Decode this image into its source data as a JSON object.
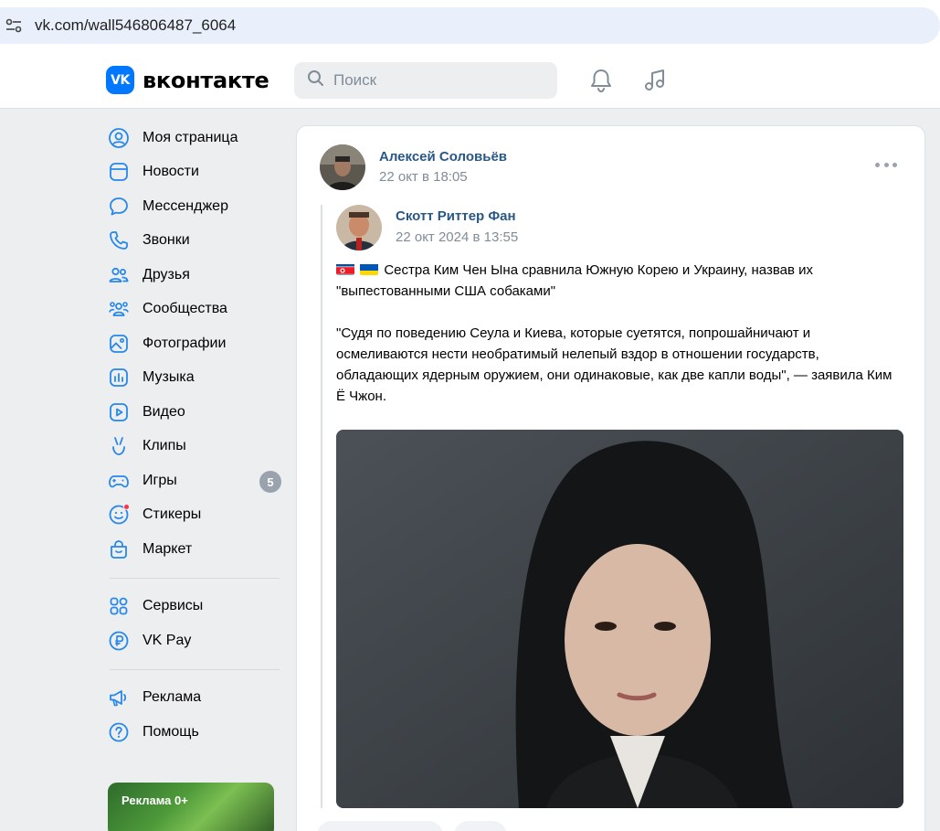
{
  "browser": {
    "url": "vk.com/wall546806487_6064"
  },
  "header": {
    "logo_text": "вконтакте",
    "logo_badge": "VK",
    "search_placeholder": "Поиск",
    "icons": [
      "bell-icon",
      "music-note-icon"
    ]
  },
  "sidebar": {
    "items": [
      {
        "label": "Моя страница",
        "icon": "user-circle-icon"
      },
      {
        "label": "Новости",
        "icon": "newsfeed-icon"
      },
      {
        "label": "Мессенджер",
        "icon": "message-bubble-icon"
      },
      {
        "label": "Звонки",
        "icon": "phone-icon"
      },
      {
        "label": "Друзья",
        "icon": "friends-icon"
      },
      {
        "label": "Сообщества",
        "icon": "communities-icon"
      },
      {
        "label": "Фотографии",
        "icon": "photo-icon"
      },
      {
        "label": "Музыка",
        "icon": "music-bars-icon"
      },
      {
        "label": "Видео",
        "icon": "video-icon"
      },
      {
        "label": "Клипы",
        "icon": "clips-icon"
      },
      {
        "label": "Игры",
        "icon": "gamepad-icon",
        "badge": "5"
      },
      {
        "label": "Стикеры",
        "icon": "smile-icon"
      },
      {
        "label": "Маркет",
        "icon": "market-bag-icon"
      }
    ],
    "items2": [
      {
        "label": "Сервисы",
        "icon": "services-grid-icon"
      },
      {
        "label": "VK Pay",
        "icon": "ruble-icon"
      }
    ],
    "items3": [
      {
        "label": "Реклама",
        "icon": "megaphone-icon"
      },
      {
        "label": "Помощь",
        "icon": "help-icon"
      }
    ],
    "ad_label": "Реклама 0+"
  },
  "post": {
    "author": "Алексей Соловьёв",
    "date": "22 окт в 18:05",
    "repost": {
      "author": "Скотт Риттер Фан",
      "date": "22 окт 2024 в 13:55",
      "text_line1": "Сестра Ким Чен Ына сравнила Южную Корею и Украину, назвав их \"выпестованными США собаками\"",
      "text_line2": "\"Судя по поведению Сеула и Киева, которые суетятся, попрошайничают и осмеливаются нести необратимый нелепый вздор в отношении государств, обладающих ядерным оружием, они одинаковые, как две капли воды\", — заявила Ким Ё Чжон."
    }
  },
  "colors": {
    "accent": "#0077ff",
    "link": "#2a5885",
    "muted": "#818c99",
    "background": "#edeef0"
  }
}
